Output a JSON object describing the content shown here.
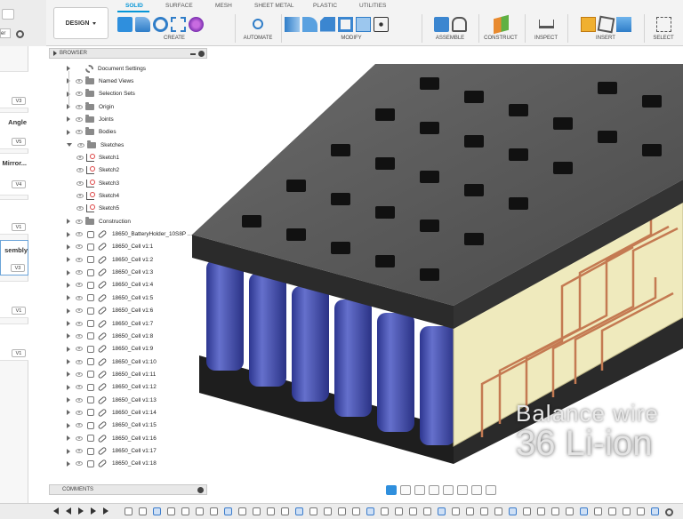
{
  "toolbar": {
    "workspace": "DESIGN",
    "tabs": [
      "SOLID",
      "SURFACE",
      "MESH",
      "SHEET METAL",
      "PLASTIC",
      "UTILITIES"
    ],
    "active_tab": "SOLID",
    "groups": [
      "CREATE",
      "AUTOMATE",
      "MODIFY",
      "ASSEMBLE",
      "CONSTRUCT",
      "INSPECT",
      "INSERT",
      "SELECT"
    ],
    "left_stub_text": "er"
  },
  "left_panel": {
    "items": [
      {
        "label": "",
        "version": "V3"
      },
      {
        "label": "Angle",
        "version": "V5"
      },
      {
        "label": "Mirror...",
        "version": "V4"
      },
      {
        "label": "",
        "version": "V1"
      },
      {
        "label": "sembly",
        "version": "V3"
      },
      {
        "label": "",
        "version": "V1"
      },
      {
        "label": "",
        "version": "V1"
      }
    ]
  },
  "browser": {
    "title": "BROWSER",
    "nodes": [
      {
        "label": "Document Settings",
        "kind": "gear",
        "level": 0
      },
      {
        "label": "Named Views",
        "kind": "folder",
        "level": 0
      },
      {
        "label": "Selection Sets",
        "kind": "folder",
        "level": 0
      },
      {
        "label": "Origin",
        "kind": "folder",
        "level": 0
      },
      {
        "label": "Joints",
        "kind": "folder",
        "level": 0
      },
      {
        "label": "Bodies",
        "kind": "folder",
        "level": 0
      },
      {
        "label": "Sketches",
        "kind": "folder",
        "level": 0
      },
      {
        "label": "Sketch1",
        "kind": "sketch",
        "level": 1
      },
      {
        "label": "Sketch2",
        "kind": "sketch",
        "level": 1
      },
      {
        "label": "Sketch3",
        "kind": "sketch",
        "level": 1
      },
      {
        "label": "Sketch4",
        "kind": "sketch",
        "level": 1
      },
      {
        "label": "Sketch5",
        "kind": "sketch",
        "level": 1
      },
      {
        "label": "Construction",
        "kind": "folder",
        "level": 0
      },
      {
        "label": "18650_BatteryHolder_10S8P ...",
        "kind": "component",
        "level": 0
      },
      {
        "label": "18650_Cell v1:1",
        "kind": "component",
        "level": 0
      },
      {
        "label": "18650_Cell v1:2",
        "kind": "component",
        "level": 0
      },
      {
        "label": "18650_Cell v1:3",
        "kind": "component",
        "level": 0
      },
      {
        "label": "18650_Cell v1:4",
        "kind": "component",
        "level": 0
      },
      {
        "label": "18650_Cell v1:5",
        "kind": "component",
        "level": 0
      },
      {
        "label": "18650_Cell v1:6",
        "kind": "component",
        "level": 0
      },
      {
        "label": "18650_Cell v1:7",
        "kind": "component",
        "level": 0
      },
      {
        "label": "18650_Cell v1:8",
        "kind": "component",
        "level": 0
      },
      {
        "label": "18650_Cell v1:9",
        "kind": "component",
        "level": 0
      },
      {
        "label": "18650_Cell v1:10",
        "kind": "component",
        "level": 0
      },
      {
        "label": "18650_Cell v1:11",
        "kind": "component",
        "level": 0
      },
      {
        "label": "18650_Cell v1:12",
        "kind": "component",
        "level": 0
      },
      {
        "label": "18650_Cell v1:13",
        "kind": "component",
        "level": 0
      },
      {
        "label": "18650_Cell v1:14",
        "kind": "component",
        "level": 0
      },
      {
        "label": "18650_Cell v1:15",
        "kind": "component",
        "level": 0
      },
      {
        "label": "18650_Cell v1:16",
        "kind": "component",
        "level": 0
      },
      {
        "label": "18650_Cell v1:17",
        "kind": "component",
        "level": 0
      },
      {
        "label": "18650_Cell v1:18",
        "kind": "component",
        "level": 0
      }
    ]
  },
  "comments": {
    "title": "COMMENTS"
  },
  "overlay": {
    "line1": "Balance wire",
    "line2": "36 Li-ion"
  },
  "colors": {
    "accent": "#0696d7",
    "cell": "#4a55b0",
    "pcb": "#efeabd",
    "wire": "#c47a52",
    "holder": "#3a3a3a"
  }
}
